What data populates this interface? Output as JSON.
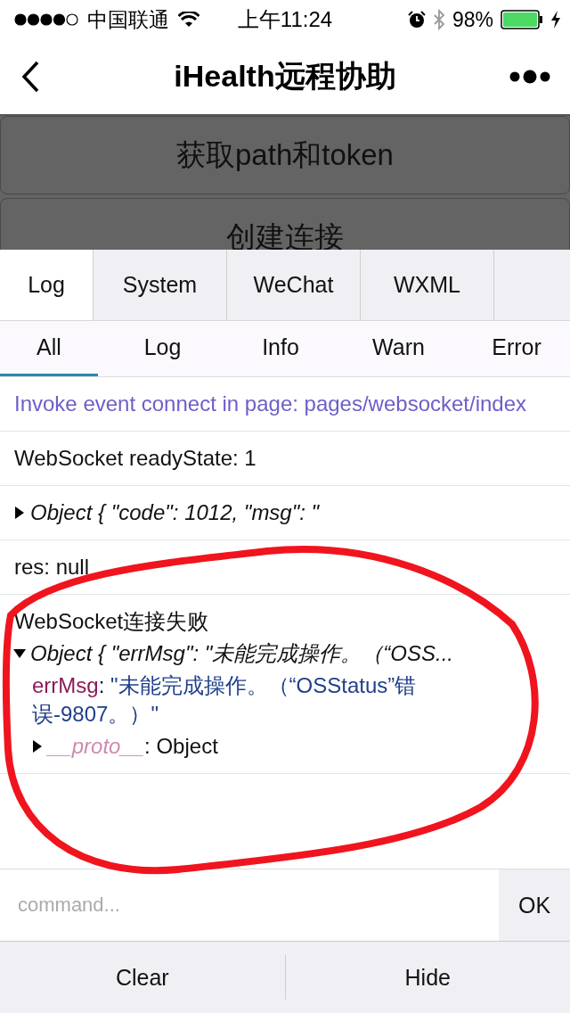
{
  "status_bar": {
    "carrier": "中国联通",
    "time": "上午11:24",
    "battery": "98%"
  },
  "nav": {
    "title": "iHealth远程协助"
  },
  "page_buttons": [
    "获取path和token",
    "创建连接"
  ],
  "tabs": [
    {
      "label": "Log",
      "selected": true
    },
    {
      "label": "System",
      "selected": false
    },
    {
      "label": "WeChat",
      "selected": false
    },
    {
      "label": "WXML",
      "selected": false
    }
  ],
  "filters": [
    {
      "label": "All",
      "selected": true
    },
    {
      "label": "Log",
      "selected": false
    },
    {
      "label": "Info",
      "selected": false
    },
    {
      "label": "Warn",
      "selected": false
    },
    {
      "label": "Error",
      "selected": false
    }
  ],
  "logs": [
    {
      "kind": "info",
      "text": "Invoke event connect in page: pages/websocket/index"
    },
    {
      "kind": "log",
      "text": "WebSocket readyState: 1"
    },
    {
      "kind": "object",
      "summary": "Object { \"code\": 1012, \"msg\": \"",
      "expanded": false
    },
    {
      "kind": "log",
      "text": "res: null"
    },
    {
      "kind": "object",
      "title": "WebSocket连接失败",
      "summary": "Object { \"errMsg\": \"未能完成操作。（“OSS...",
      "expanded": true,
      "properties": [
        {
          "kind": "string",
          "key": "errMsg",
          "separator": ":",
          "value": "\"未能完成操作。（“OSStatus”错误-9807。）\""
        },
        {
          "kind": "proto",
          "key": "__proto__",
          "separator": ":",
          "value": "Object",
          "expanded": false
        }
      ]
    }
  ],
  "command": {
    "placeholder": "command...",
    "button": "OK"
  },
  "bottom_buttons": [
    "Clear",
    "Hide"
  ]
}
